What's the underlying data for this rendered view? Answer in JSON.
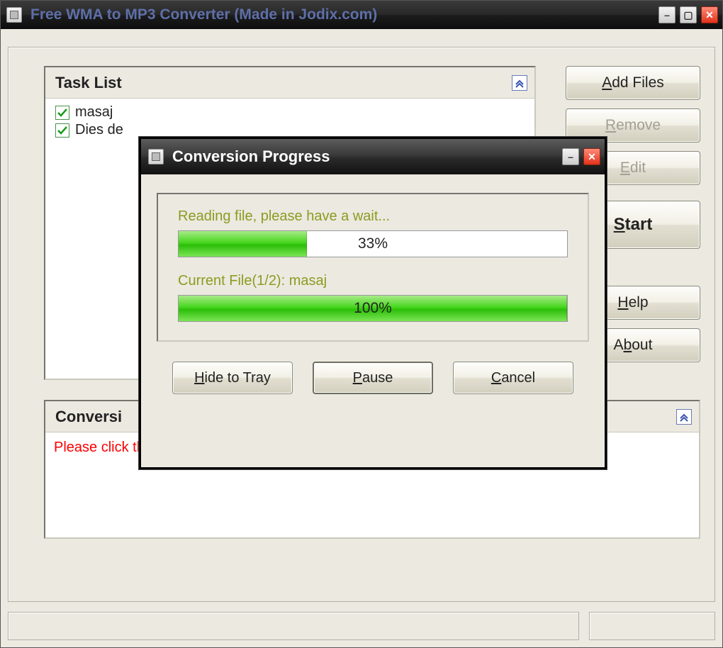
{
  "window": {
    "title": "Free WMA to MP3 Converter   (Made in Jodix.com)"
  },
  "panels": {
    "task_header": "Task List",
    "task_items": [
      {
        "label": "masaj",
        "checked": true
      },
      {
        "label": "Dies de",
        "checked": true
      }
    ],
    "log_header": "Conversi",
    "log_message": "Please click the \"Add Files\" button to add files."
  },
  "buttons": {
    "add_files": "Add Files",
    "remove": "Remove",
    "edit": "Edit",
    "start": "Start",
    "help": "Help",
    "about": "About"
  },
  "dialog": {
    "title": "Conversion Progress",
    "label1": "Reading file, please have a wait...",
    "progress1_pct": "33%",
    "progress1_val": 33,
    "label2": "Current File(1/2): masaj",
    "progress2_pct": "100%",
    "progress2_val": 100,
    "btn_hide": "Hide to Tray",
    "btn_pause": "Pause",
    "btn_cancel": "Cancel"
  }
}
